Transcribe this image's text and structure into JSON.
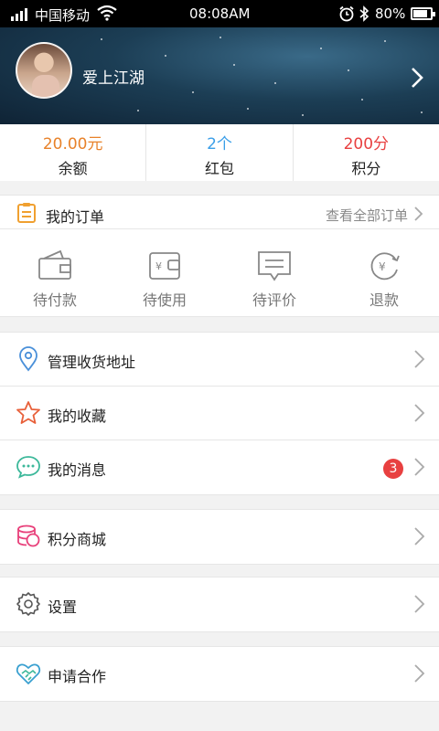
{
  "status_bar": {
    "carrier": "中国移动",
    "time": "08:08AM",
    "battery": "80%"
  },
  "profile": {
    "username": "爱上江湖"
  },
  "stats": [
    {
      "value": "20.00元",
      "label": "余额",
      "color": "#e8822a"
    },
    {
      "value": "2个",
      "label": "红包",
      "color": "#3a9ee8"
    },
    {
      "value": "200分",
      "label": "积分",
      "color": "#e84040"
    }
  ],
  "orders": {
    "title": "我的订单",
    "view_all": "查看全部订单",
    "statuses": [
      {
        "label": "待付款",
        "icon": "wallet-icon"
      },
      {
        "label": "待使用",
        "icon": "yen-wallet-icon"
      },
      {
        "label": "待评价",
        "icon": "comment-icon"
      },
      {
        "label": "退款",
        "icon": "refund-icon"
      }
    ]
  },
  "menu": {
    "address": "管理收货地址",
    "favorites": "我的收藏",
    "messages": "我的消息",
    "messages_badge": "3",
    "points_mall": "积分商城",
    "settings": "设置",
    "cooperation": "申请合作"
  }
}
